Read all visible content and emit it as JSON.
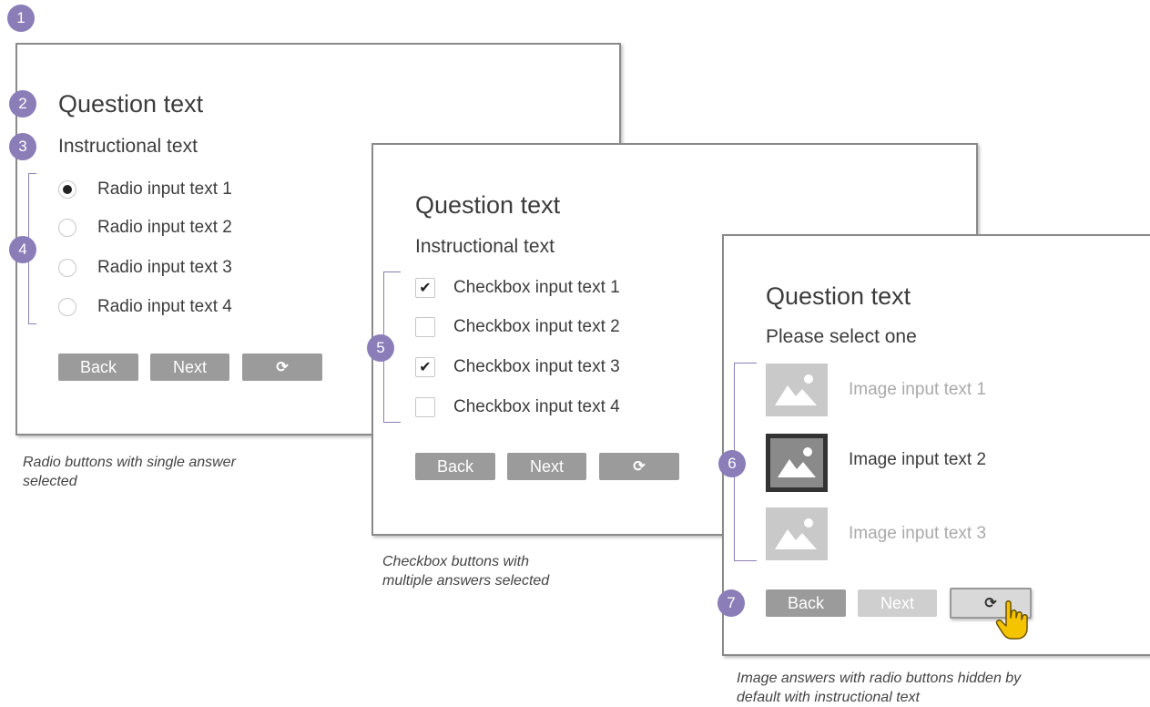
{
  "badges": [
    "1",
    "2",
    "3",
    "4",
    "5",
    "6",
    "7"
  ],
  "card1": {
    "question": "Question text",
    "instruction": "Instructional text",
    "options": [
      "Radio input text 1",
      "Radio input text 2",
      "Radio input text 3",
      "Radio input text 4"
    ],
    "selected_index": 0,
    "buttons": {
      "back": "Back",
      "next": "Next",
      "refresh": "⟳"
    }
  },
  "card2": {
    "question": "Question text",
    "instruction": "Instructional text",
    "options": [
      "Checkbox input text 1",
      "Checkbox input text 2",
      "Checkbox input text 3",
      "Checkbox input text 4"
    ],
    "checked": [
      true,
      false,
      true,
      false
    ],
    "check_glyph": "✔",
    "buttons": {
      "back": "Back",
      "next": "Next",
      "refresh": "⟳"
    }
  },
  "card3": {
    "question": "Question text",
    "instruction": "Please select one",
    "options": [
      "Image input text 1",
      "Image input text 2",
      "Image input text 3"
    ],
    "selected_index": 1,
    "buttons": {
      "back": "Back",
      "next": "Next",
      "refresh": "⟳"
    }
  },
  "captions": {
    "radio": [
      "Radio buttons with single answer",
      "selected"
    ],
    "checkbox": [
      "Checkbox buttons with",
      "multiple answers selected"
    ],
    "image": [
      "Image answers with radio buttons hidden by",
      "default with instructional text"
    ]
  },
  "colors": {
    "badge": "#8b7db8",
    "button": "#9b9b9b",
    "button_disabled": "#cfcfcf",
    "image_placeholder": "#c9c9c9",
    "image_selected": "#8a8a8a",
    "cursor": "#f5c400"
  },
  "icons": {
    "cursor": "hand-pointer-icon",
    "refresh": "refresh-icon",
    "image": "image-placeholder-icon"
  }
}
